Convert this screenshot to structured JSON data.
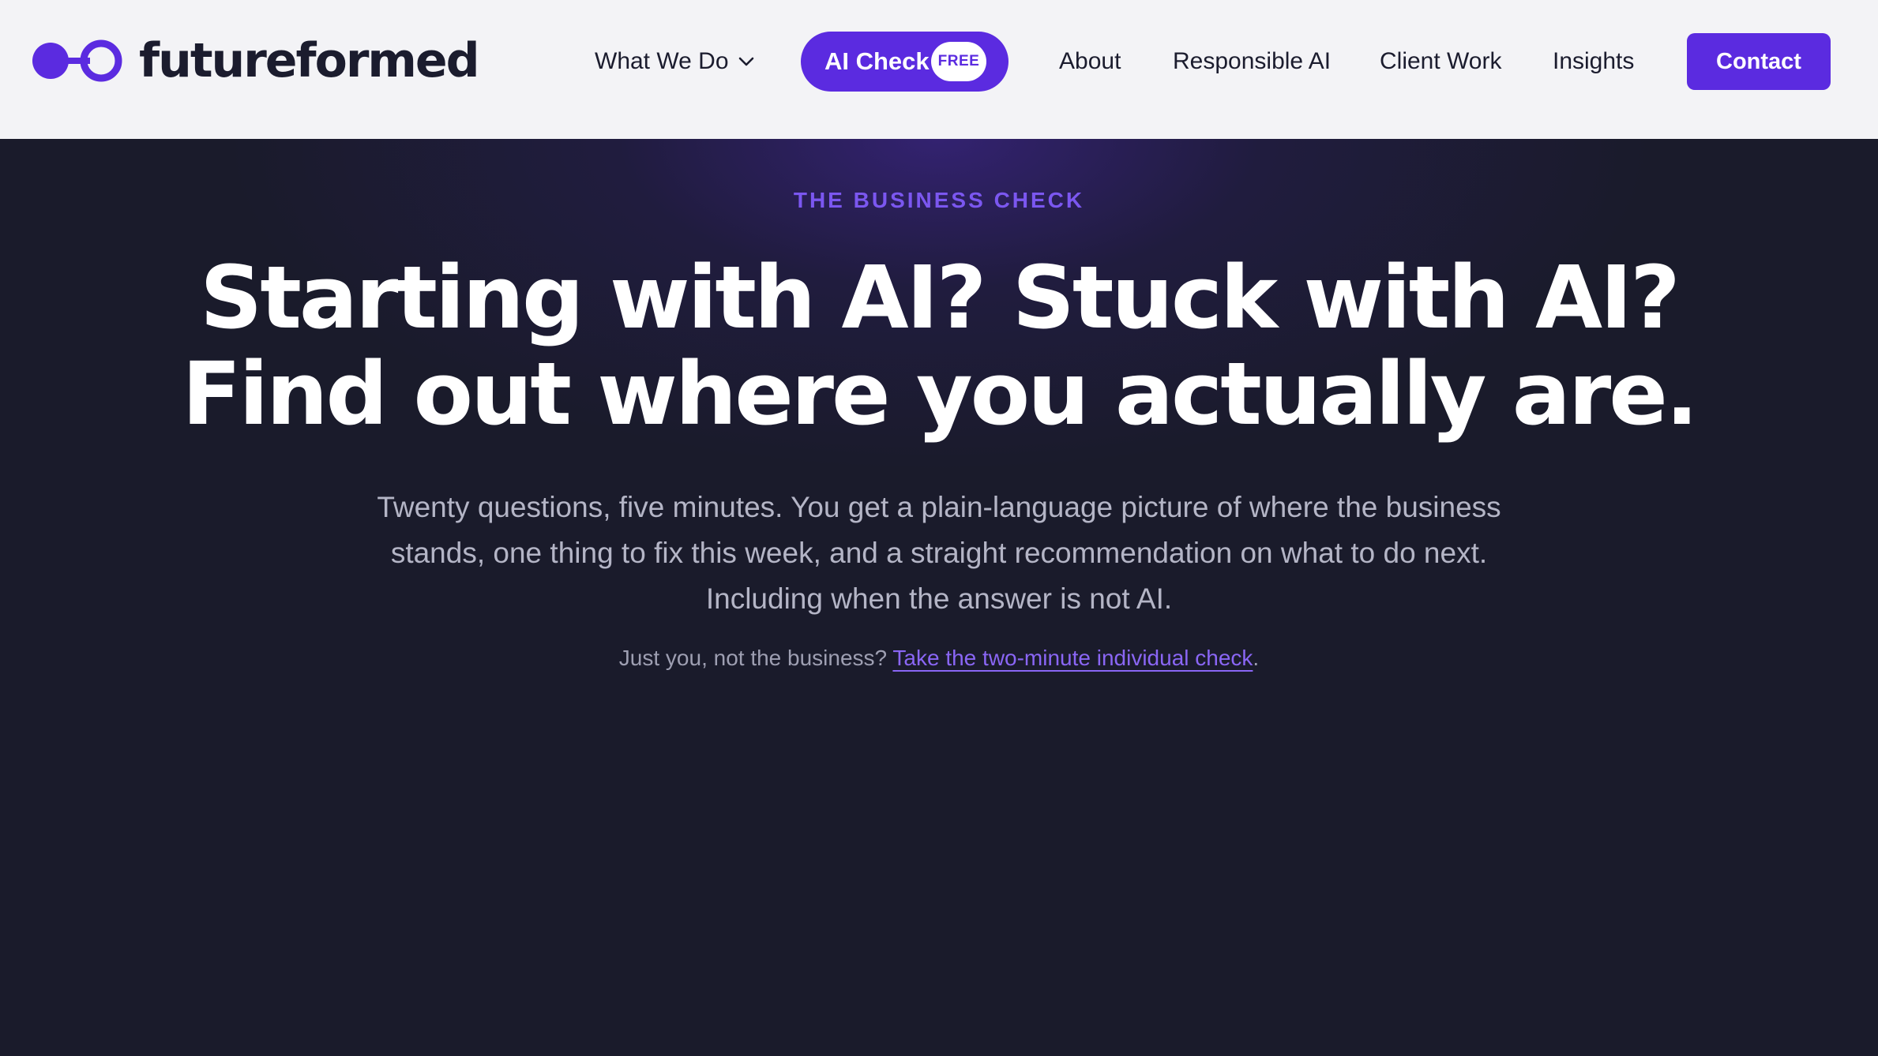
{
  "brand": {
    "name": "futureformed",
    "accent_color": "#5b2be0",
    "logo_icon": "two-circles-logo-icon"
  },
  "nav": {
    "what_we_do": "What We Do",
    "ai_check": "AI Check",
    "ai_check_badge": "FREE",
    "about": "About",
    "responsible_ai": "Responsible AI",
    "client_work": "Client Work",
    "insights": "Insights",
    "contact": "Contact"
  },
  "hero": {
    "eyebrow": "THE BUSINESS CHECK",
    "headline_line1": "Starting with AI? Stuck with AI?",
    "headline_line2": "Find out where you actually are.",
    "subtext": "Twenty questions, five minutes. You get a plain-language picture of where the business stands, one thing to fix this week, and a straight recommendation on what to do next. Including when the answer is not AI.",
    "alt_prefix": "Just you, not the business?",
    "alt_link": "Take the two-minute individual check",
    "alt_suffix": "."
  }
}
